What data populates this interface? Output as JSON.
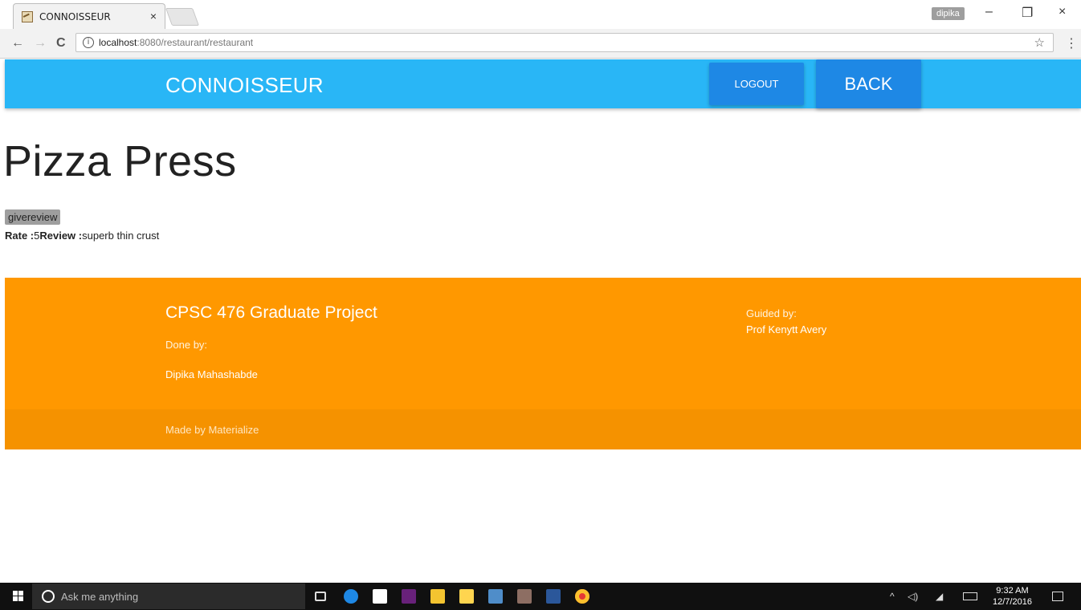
{
  "browser": {
    "tab_title": "CONNOISSEUR",
    "tab_close": "×",
    "profile_name": "dipika",
    "window_controls": {
      "minimize": "–",
      "restore": "❐",
      "close": "×"
    },
    "back_icon": "←",
    "forward_icon": "→",
    "reload_icon": "C",
    "info_icon": "i",
    "url_host": "localhost",
    "url_path": ":8080/restaurant/restaurant",
    "bookmark_icon": "☆",
    "menu_icon": "⋮"
  },
  "navbar": {
    "brand": "CONNOISSEUR",
    "logout_label": "LOGOUT",
    "back_label": "BACK",
    "bg_color": "#29b6f6",
    "button_color": "#1e88e5"
  },
  "main": {
    "title": "Pizza Press",
    "givereview_label": "givereview",
    "review": {
      "rate_label": "Rate :",
      "rate_value": "5",
      "review_label": "Review :",
      "review_text": "superb thin crust"
    }
  },
  "footer": {
    "project_title": "CPSC 476 Graduate Project",
    "done_by_label": "Done by:",
    "author": "Dipika Mahashabde",
    "guided_by_label": "Guided by:",
    "guide": "Prof Kenytt Avery",
    "copyright": "Made by Materialize",
    "bg_color": "#ff9800"
  },
  "taskbar": {
    "search_placeholder": "Ask me anything",
    "mic_icon": "🎙",
    "tray_caret": "^",
    "time": "9:32 AM",
    "date": "12/7/2016"
  }
}
